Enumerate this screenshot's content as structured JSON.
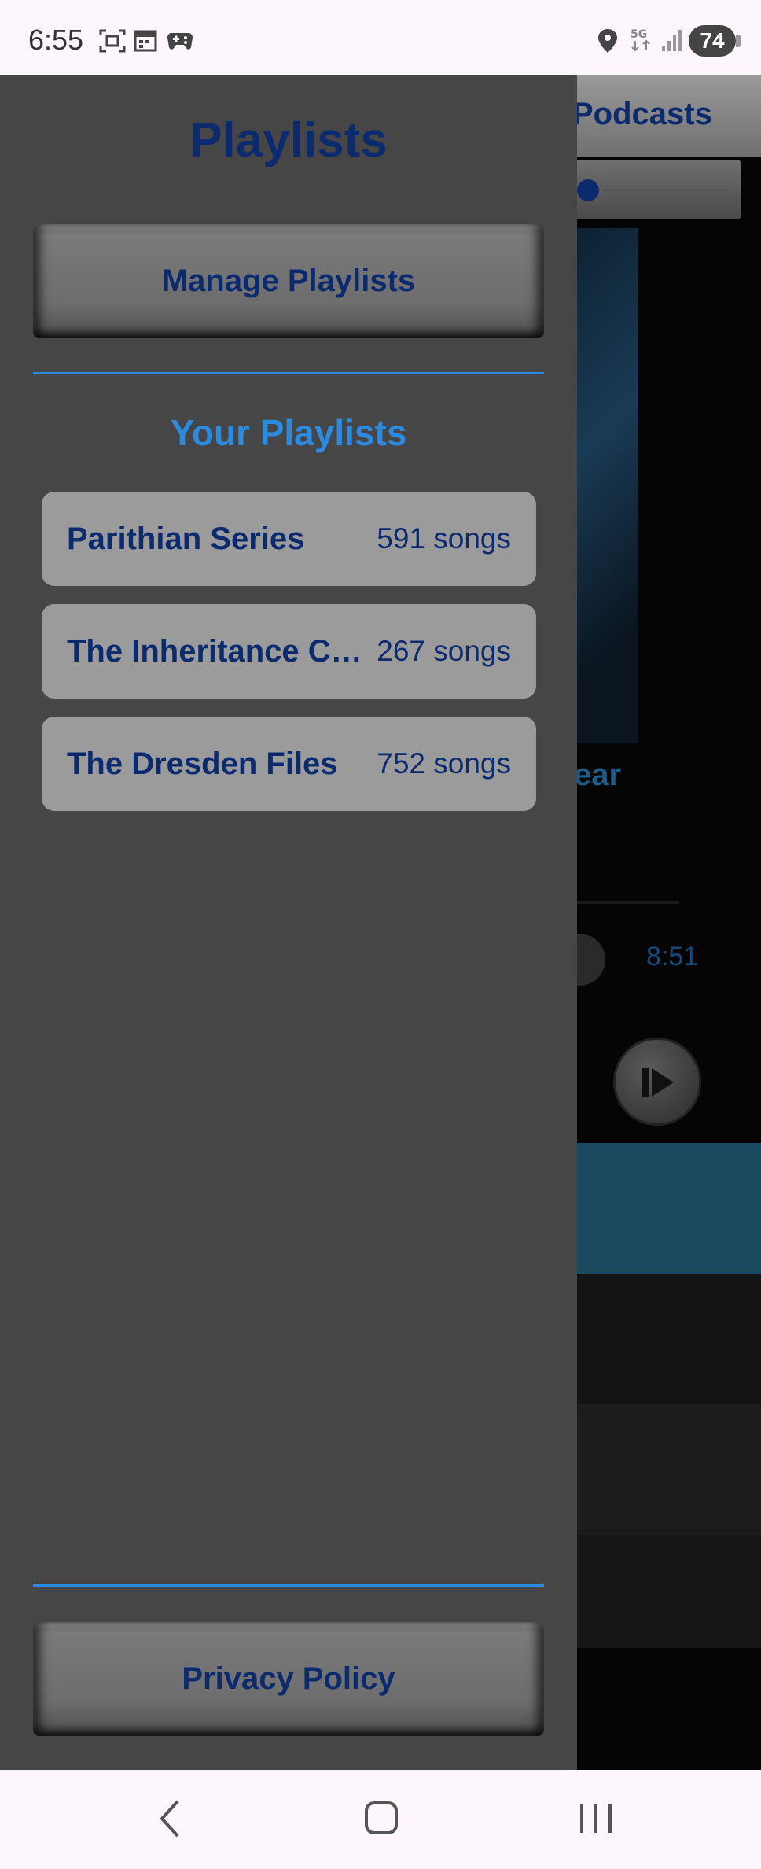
{
  "status_bar": {
    "time": "6:55",
    "battery": "74",
    "icons": [
      "screenshot-icon",
      "calendar-icon",
      "game-controller-icon",
      "location-icon",
      "5g-icon",
      "signal-icon",
      "battery-icon"
    ]
  },
  "background_app": {
    "tab_label": "Podcasts",
    "track_title_fragment": "ear",
    "duration": "8:51",
    "accent": "#1b4a60"
  },
  "drawer": {
    "title": "Playlists",
    "manage_button": "Manage Playlists",
    "section_heading": "Your Playlists",
    "playlists": [
      {
        "name": "Parithian Series",
        "count": "591 songs"
      },
      {
        "name": "The Inheritance Cycle",
        "count": "267 songs"
      },
      {
        "name": "The Dresden Files",
        "count": "752 songs"
      }
    ],
    "privacy_button": "Privacy Policy"
  },
  "nav_bar": {
    "icons": [
      "back-icon",
      "home-icon",
      "recents-icon"
    ]
  },
  "colors": {
    "drawer_bg": "#464646",
    "title_text": "#0c2a6e",
    "accent_blue": "#2b8be0",
    "item_bg": "#9b9b9b"
  }
}
